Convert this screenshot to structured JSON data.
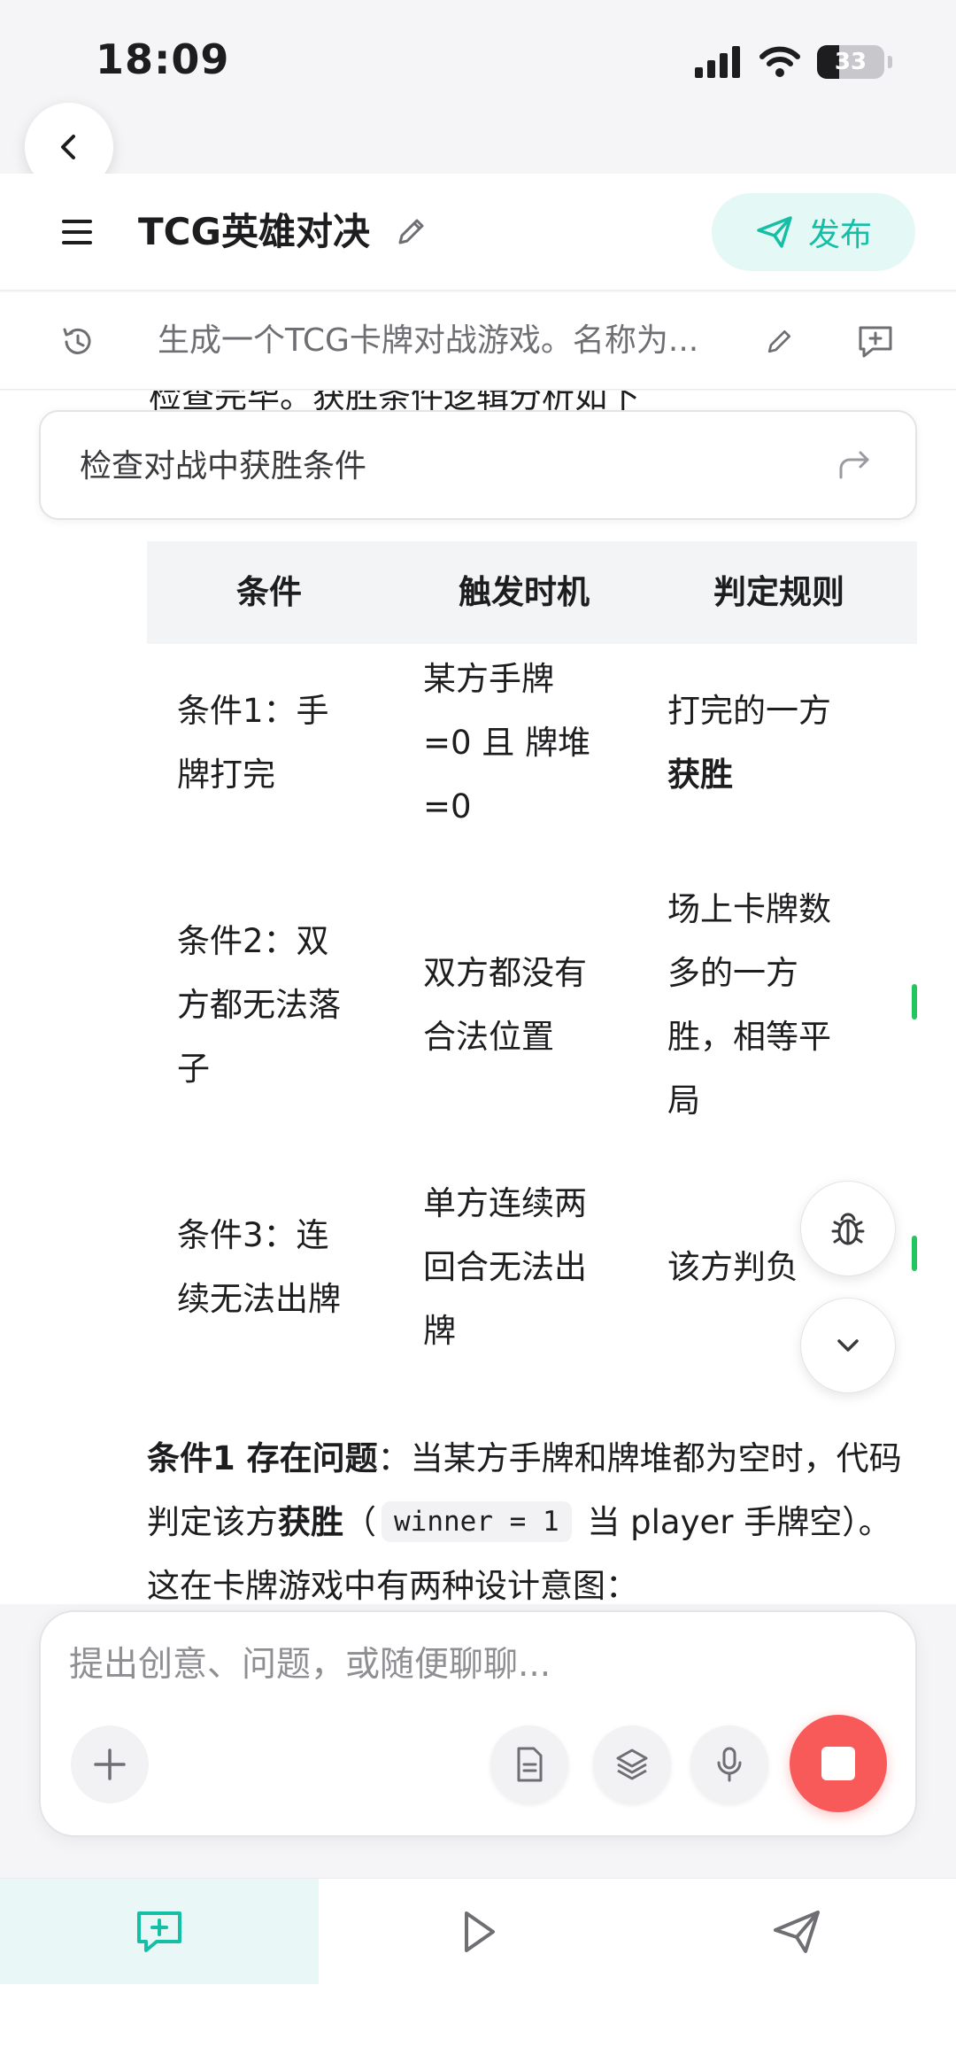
{
  "status_bar": {
    "time": "18:09",
    "battery": "33"
  },
  "header": {
    "title": "TCG英雄对决",
    "publish_label": "发布"
  },
  "prompt_bar": {
    "text": "生成一个TCG卡牌对战游戏。名称为..."
  },
  "content": {
    "clipped_line": "检查完毕。获胜条件逻辑分析如下",
    "search_card": "检查对战中获胜条件",
    "table": {
      "headers": [
        "条件",
        "触发时机",
        "判定规则"
      ],
      "rows": [
        {
          "c1a": "条件1：手",
          "c1b": "牌打完",
          "c2a": "某方手牌",
          "c2b": "=0 且 牌堆",
          "c2c": "=0",
          "c3a": "打完的一方",
          "c3b": "获胜"
        },
        {
          "c1a": "条件2：双",
          "c1b": "方都无法落",
          "c1c": "子",
          "c2a": "双方都没有",
          "c2b": "合法位置",
          "c3a": "场上卡牌数",
          "c3b": "多的一方",
          "c3c": "胜，相等平",
          "c3d": "局"
        },
        {
          "c1a": "条件3：连",
          "c1b": "续无法出牌",
          "c2a": "单方连续两",
          "c2b": "回合无法出",
          "c2c": "牌",
          "c3a": "该方判负"
        }
      ]
    },
    "paragraph": {
      "bold1": "条件1 存在问题",
      "t1": "：当某方手牌和牌堆都为空时，代码判定该方",
      "bold2": "获胜",
      "t2": "（",
      "code": "winner = 1",
      "t3": " 当 player 手牌空）。这在卡牌游戏中有两种设计意图："
    }
  },
  "composer": {
    "placeholder": "提出创意、问题，或随便聊聊..."
  },
  "colors": {
    "accent": "#15bfa6",
    "stop": "#f85a5a",
    "green_mark": "#22c55e"
  },
  "icons": [
    "back-icon",
    "menu-icon",
    "edit-icon",
    "send-icon",
    "history-icon",
    "new-chat-icon",
    "share-icon",
    "bug-icon",
    "chevron-down-icon",
    "plus-icon",
    "document-icon",
    "layers-icon",
    "microphone-icon",
    "stop-icon",
    "chat-icon",
    "play-icon"
  ]
}
